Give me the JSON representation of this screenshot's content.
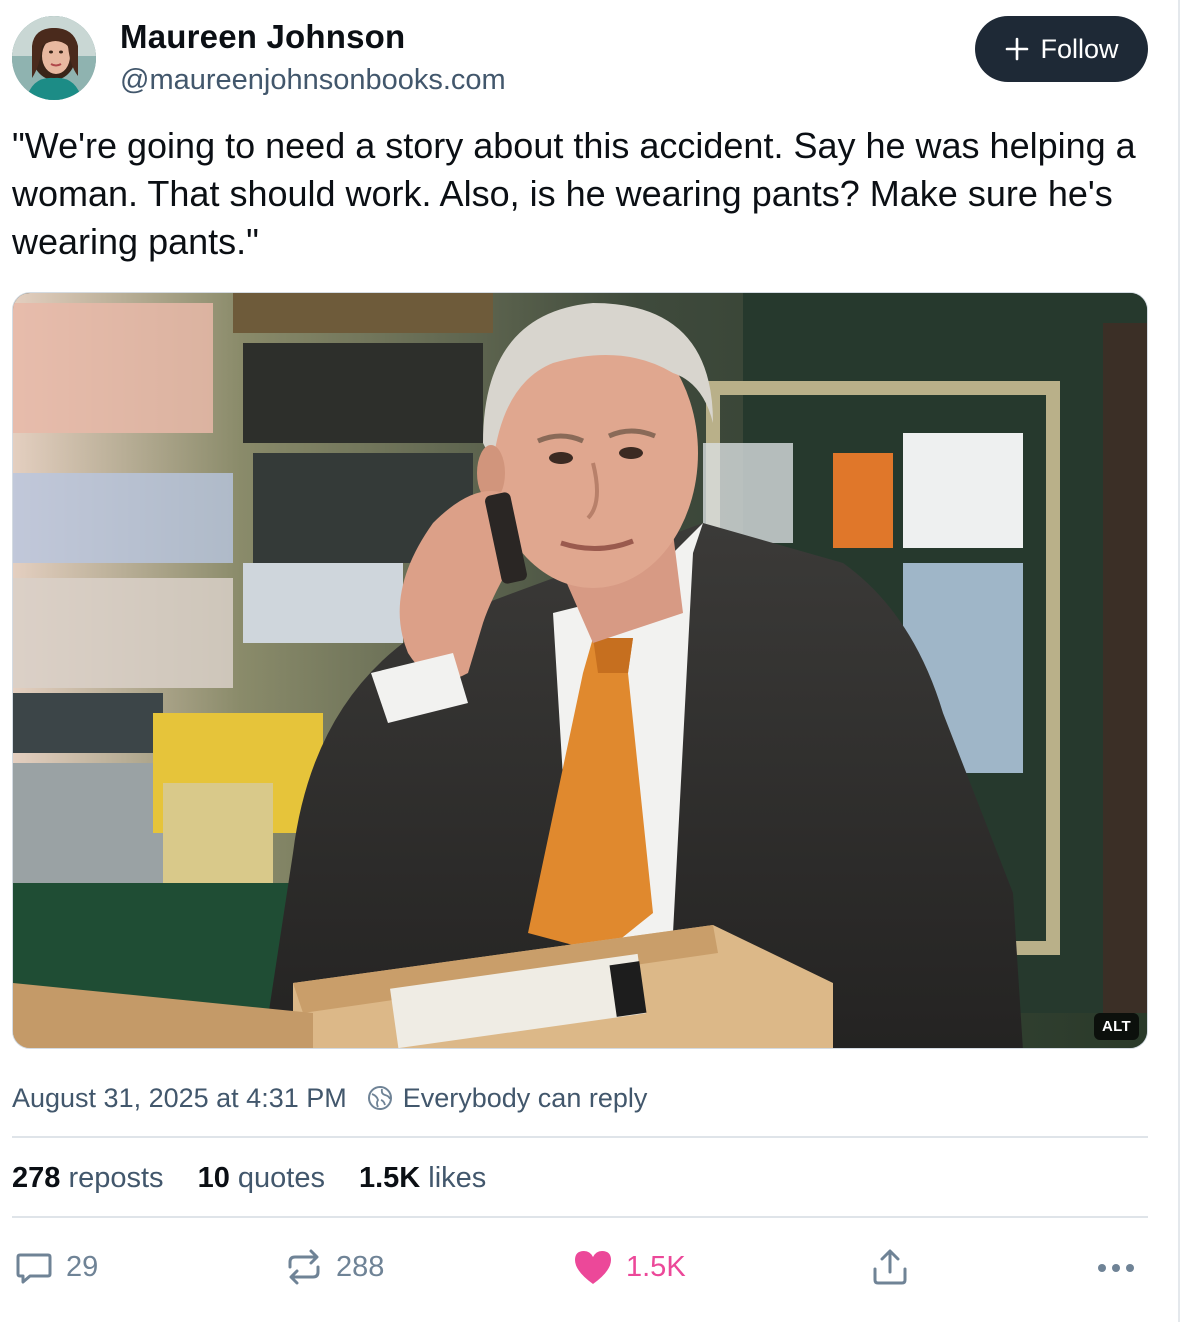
{
  "author": {
    "display_name": "Maureen Johnson",
    "handle": "@maureenjohnsonbooks.com"
  },
  "follow_button": {
    "label": "Follow",
    "icon": "plus-icon"
  },
  "post": {
    "text": "\"We're going to need a story about this accident. Say he was helping a woman. That should work. Also, is he wearing pants? Make sure he's wearing pants.\"",
    "alt_badge": "ALT"
  },
  "meta": {
    "timestamp": "August 31, 2025 at 4:31 PM",
    "reply_setting": "Everybody can reply",
    "reply_setting_icon": "globe-icon"
  },
  "stats": {
    "reposts_count": "278",
    "reposts_label": "reposts",
    "quotes_count": "10",
    "quotes_label": "quotes",
    "likes_count": "1.5K",
    "likes_label": "likes"
  },
  "actions": {
    "reply_count": "29",
    "repost_count": "288",
    "like_count": "1.5K",
    "reply_icon": "comment-icon",
    "repost_icon": "repost-icon",
    "like_icon": "heart-icon",
    "share_icon": "share-icon",
    "more_icon": "more-icon"
  },
  "colors": {
    "follow_bg": "#1e2936",
    "secondary_text": "#42576c",
    "action_text": "#6f8396",
    "like_active": "#ec4899"
  }
}
